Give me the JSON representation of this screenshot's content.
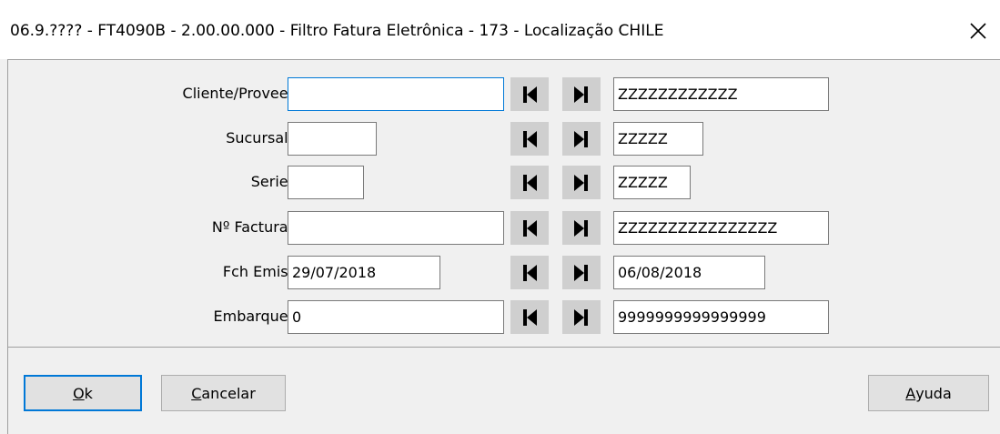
{
  "window": {
    "title": "06.9.???? - FT4090B - 2.00.00.000 - Filtro Fatura Eletrônica - 173 - Localização CHILE"
  },
  "rows": [
    {
      "label": "Cliente/Provee:",
      "from_value": "",
      "to_value": "ZZZZZZZZZZZZ"
    },
    {
      "label": "Sucursal:",
      "from_value": "",
      "to_value": "ZZZZZ"
    },
    {
      "label": "Serie:",
      "from_value": "",
      "to_value": "ZZZZZ"
    },
    {
      "label": "Nº Factura:",
      "from_value": "",
      "to_value": "ZZZZZZZZZZZZZZZZ"
    },
    {
      "label": "Fch Emis:",
      "from_value": "29/07/2018",
      "to_value": "06/08/2018"
    },
    {
      "label": "Embarque:",
      "from_value": "0",
      "to_value": "9999999999999999"
    }
  ],
  "buttons": {
    "ok": {
      "accel": "O",
      "rest": "k"
    },
    "cancel": {
      "accel": "C",
      "rest": "ancelar"
    },
    "help": {
      "accel": "A",
      "rest": "yuda"
    }
  },
  "icons": {
    "close": "close-icon",
    "first": "skip-first-icon",
    "last": "skip-last-icon"
  },
  "colors": {
    "focus_border": "#0078d7",
    "nav_button_bg": "#cfcfcf",
    "window_bg": "#f0f0f0"
  }
}
